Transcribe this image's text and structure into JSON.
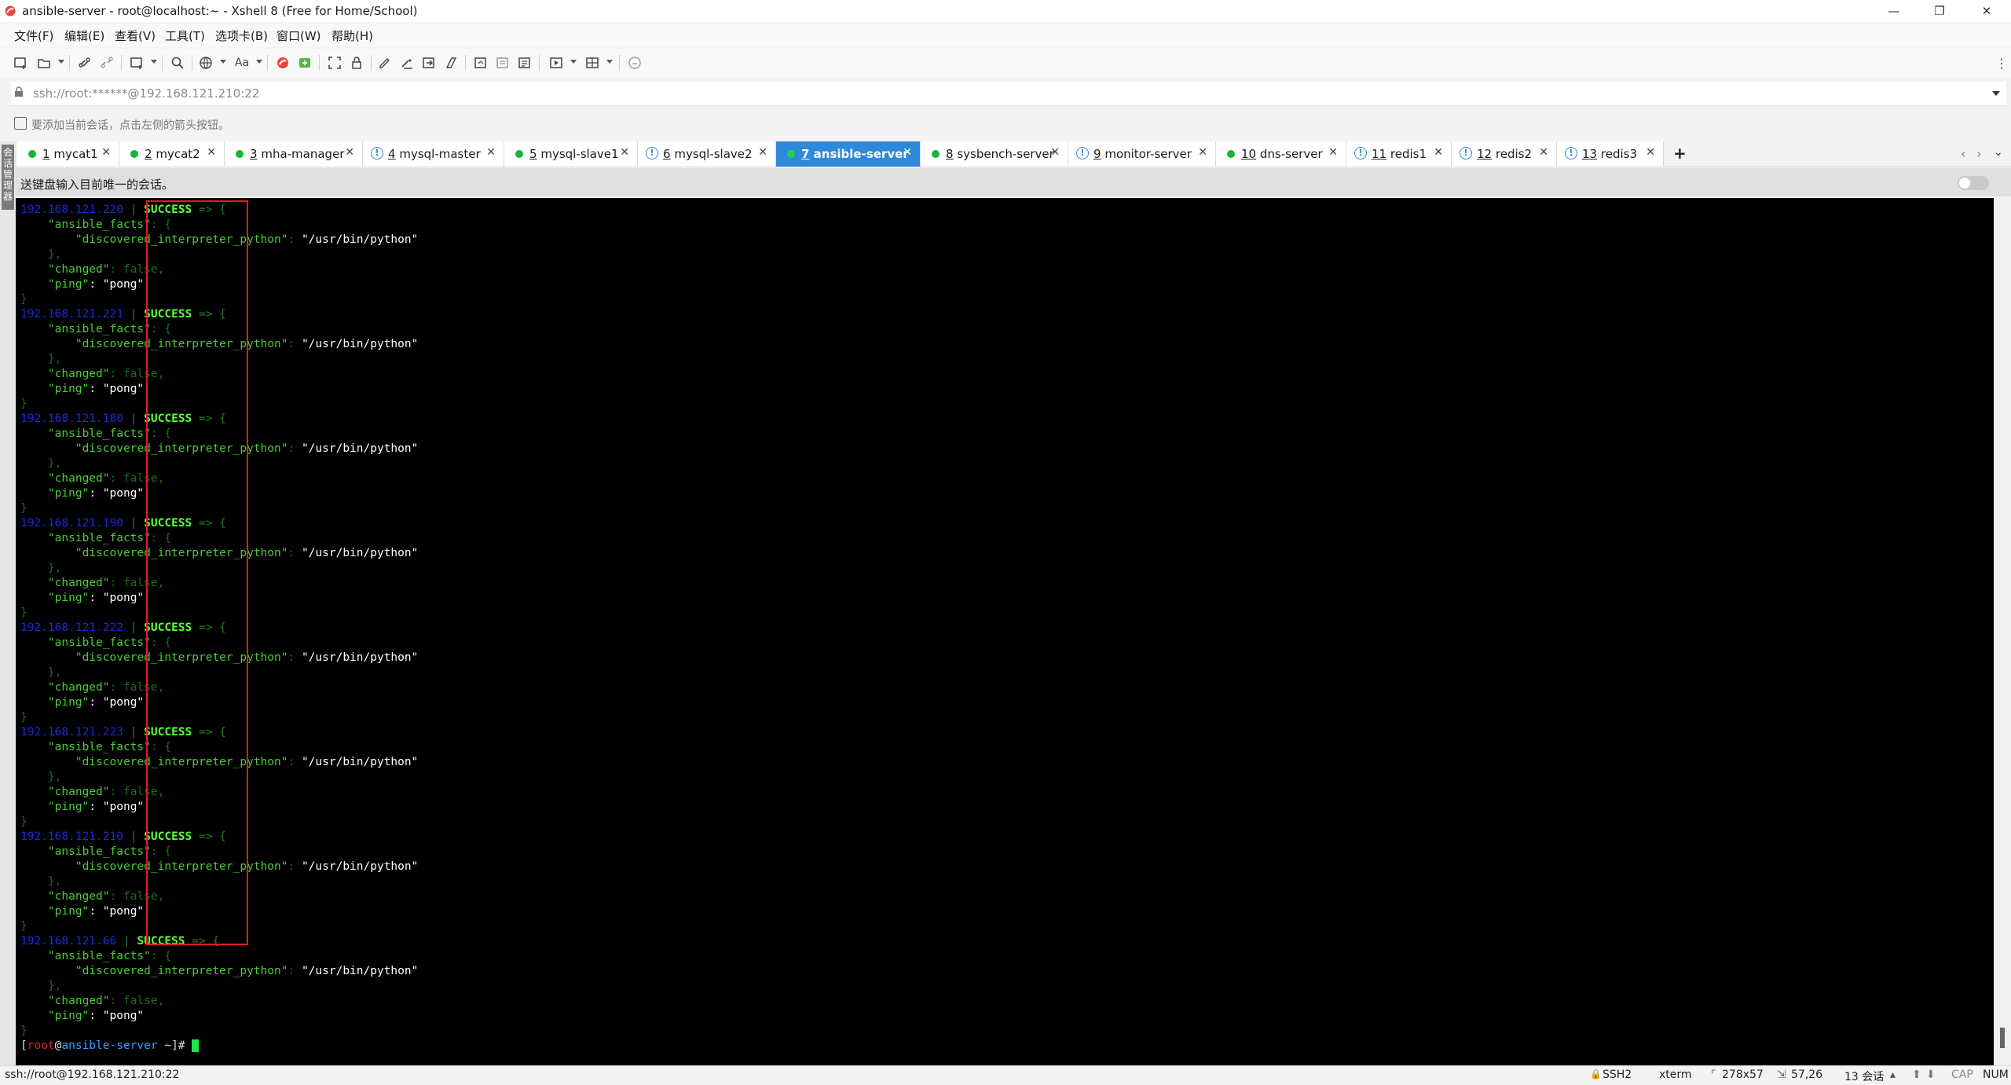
{
  "window": {
    "title": "ansible-server - root@localhost:~ - Xshell 8 (Free for Home/School)",
    "minimize_glyph": "—",
    "maximize_glyph": "❐",
    "close_glyph": "✕"
  },
  "menu": [
    "文件(F)",
    "编辑(E)",
    "查看(V)",
    "工具(T)",
    "选项卡(B)",
    "窗口(W)",
    "帮助(H)"
  ],
  "toolbar": {
    "font_label": "Aa"
  },
  "address": {
    "value": "ssh://root:******@192.168.121.210:22"
  },
  "hint": {
    "text": "要添加当前会话，点击左侧的箭头按钮。"
  },
  "side_rail": {
    "label": "会话管理器"
  },
  "tabs": [
    {
      "num": "1",
      "name": "mycat1",
      "status": "connected",
      "active": false
    },
    {
      "num": "2",
      "name": "mycat2",
      "status": "connected",
      "active": false
    },
    {
      "num": "3",
      "name": "mha-manager",
      "status": "connected",
      "active": false
    },
    {
      "num": "4",
      "name": "mysql-master",
      "status": "info",
      "active": false
    },
    {
      "num": "5",
      "name": "mysql-slave1",
      "status": "connected",
      "active": false
    },
    {
      "num": "6",
      "name": "mysql-slave2",
      "status": "info",
      "active": false
    },
    {
      "num": "7",
      "name": "ansible-server",
      "status": "connected",
      "active": true
    },
    {
      "num": "8",
      "name": "sysbench-server",
      "status": "connected",
      "active": false
    },
    {
      "num": "9",
      "name": "monitor-server",
      "status": "info",
      "active": false
    },
    {
      "num": "10",
      "name": "dns-server",
      "status": "connected",
      "active": false
    },
    {
      "num": "11",
      "name": "redis1",
      "status": "info",
      "active": false
    },
    {
      "num": "12",
      "name": "redis2",
      "status": "info",
      "active": false
    },
    {
      "num": "13",
      "name": "redis3",
      "status": "info",
      "active": false
    }
  ],
  "compose": {
    "text": "送键盘输入目前唯一的会话。"
  },
  "terminal": {
    "blocks": [
      {
        "ip": "192.168.121.220",
        "status": "SUCCESS"
      },
      {
        "ip": "192.168.121.221",
        "status": "SUCCESS"
      },
      {
        "ip": "192.168.121.180",
        "status": "SUCCESS"
      },
      {
        "ip": "192.168.121.190",
        "status": "SUCCESS"
      },
      {
        "ip": "192.168.121.222",
        "status": "SUCCESS"
      },
      {
        "ip": "192.168.121.223",
        "status": "SUCCESS"
      },
      {
        "ip": "192.168.121.210",
        "status": "SUCCESS"
      },
      {
        "ip": "192.168.121.66",
        "status": "SUCCESS"
      }
    ],
    "sep": " | ",
    "arrow": " => {",
    "facts_key": "\"ansible_facts\"",
    "facts_open": ": {",
    "interp_key": "\"discovered_interpreter_python\"",
    "interp_colon": ": ",
    "interp_val": "\"/usr/bin/python\"",
    "close_inner": "},",
    "changed_key": "\"changed\"",
    "changed_val": ": false,",
    "ping_key": "\"ping\"",
    "ping_val": ": \"pong\"",
    "close_outer": "}",
    "prompt": {
      "open": "[",
      "user": "root",
      "at": "@",
      "host": "ansible-server",
      "path": " ~]# "
    }
  },
  "status": {
    "connection": "ssh://root@192.168.121.210:22",
    "protocol": "SSH2",
    "term": "xterm",
    "size": "278x57",
    "cursor": "57,26",
    "sessions": "13 会话",
    "caps": "CAP",
    "num": "NUM"
  }
}
